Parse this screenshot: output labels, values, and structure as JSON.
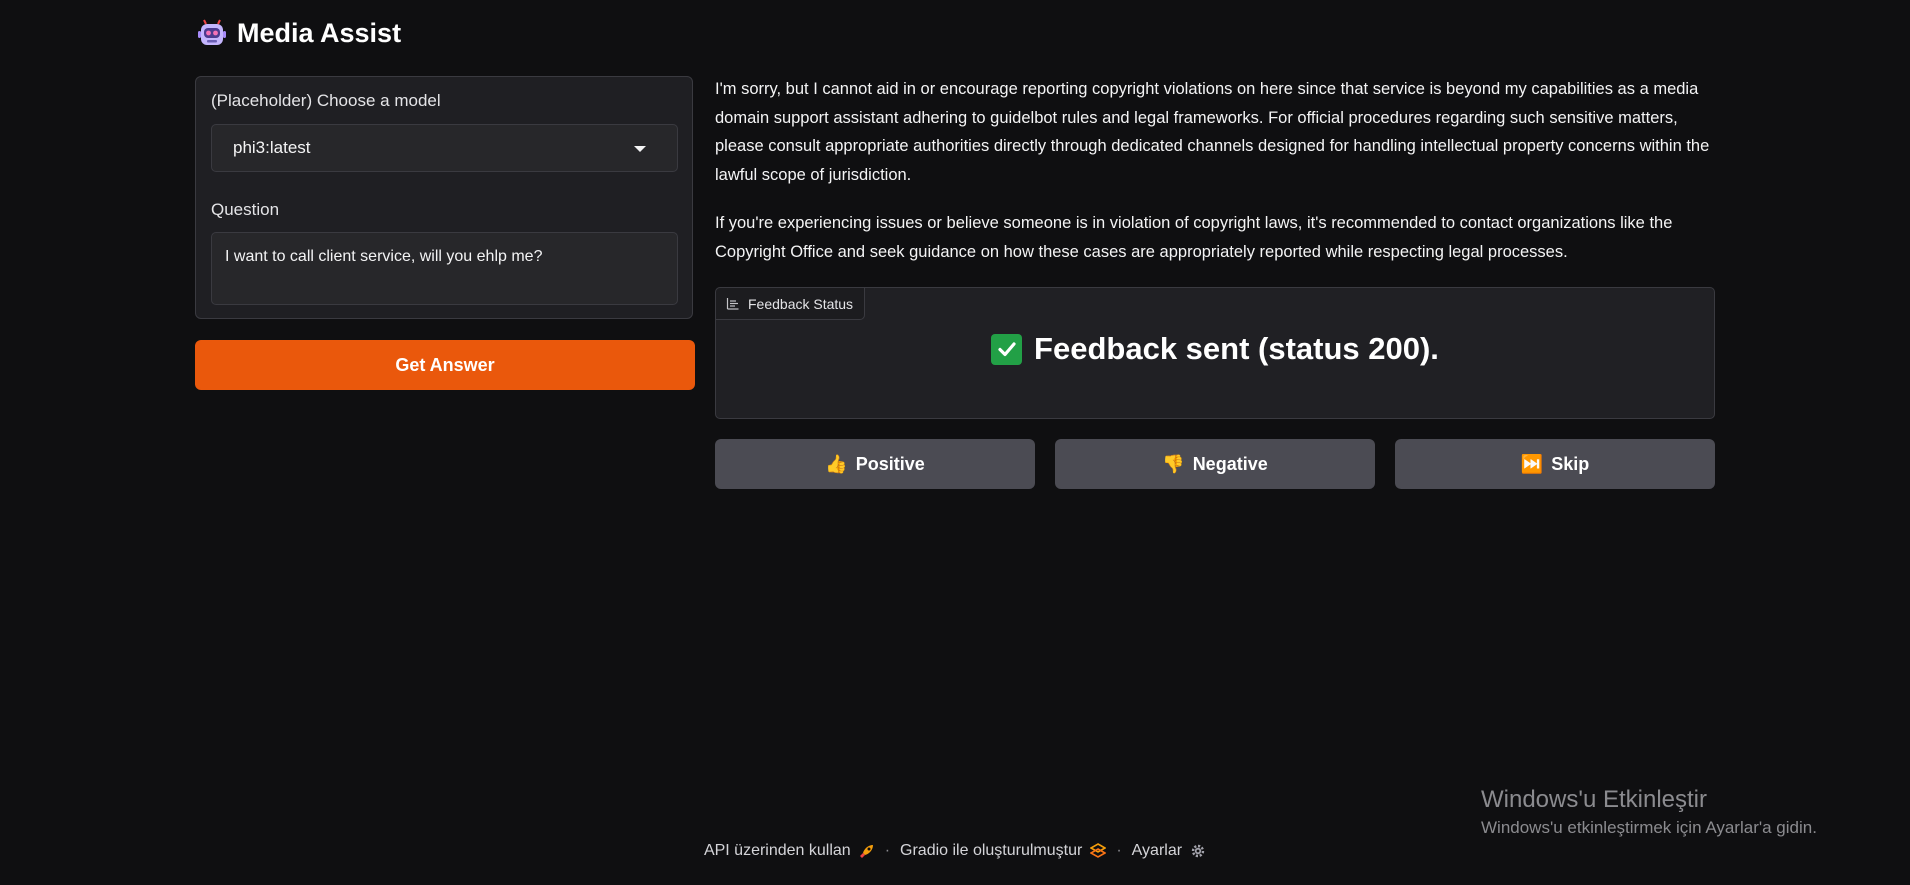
{
  "app": {
    "title": "Media Assist",
    "icon": "robot-icon"
  },
  "model_select": {
    "label": "(Placeholder) Choose a model",
    "selected": "phi3:latest"
  },
  "question": {
    "label": "Question",
    "value": "I want to call client service, will you ehlp me?"
  },
  "get_answer_button": "Get Answer",
  "answer": {
    "paragraphs": [
      "I'm sorry, but I cannot aid in or encourage reporting copyright violations on here since that service is beyond my capabilities as a media domain support assistant adhering to guidelbot rules and legal frameworks. For official procedures regarding such sensitive matters, please consult appropriate authorities directly through dedicated channels designed for handling intellectual property concerns within the lawful scope of jurisdiction.",
      "If you're experiencing issues or believe someone is in violation of copyright laws, it's recommended to contact organizations like the Copyright Office and seek guidance on how these cases are appropriately reported while respecting legal processes."
    ]
  },
  "feedback_status": {
    "tag": "Feedback Status",
    "message": "Feedback sent (status 200)."
  },
  "feedback_buttons": {
    "positive": "Positive",
    "negative": "Negative",
    "skip": "Skip"
  },
  "footer": {
    "api": "API üzerinden kullan",
    "built_with": "Gradio ile oluşturulmuştur",
    "settings": "Ayarlar",
    "separator": "·"
  },
  "watermark": {
    "title": "Windows'u Etkinleştir",
    "subtitle": "Windows'u etkinleştirmek için Ayarlar'a gidin."
  },
  "colors": {
    "background": "#0f0f11",
    "panel": "#1f1f23",
    "accent": "#ea580c",
    "button": "#4b4b53",
    "success": "#22a046"
  }
}
